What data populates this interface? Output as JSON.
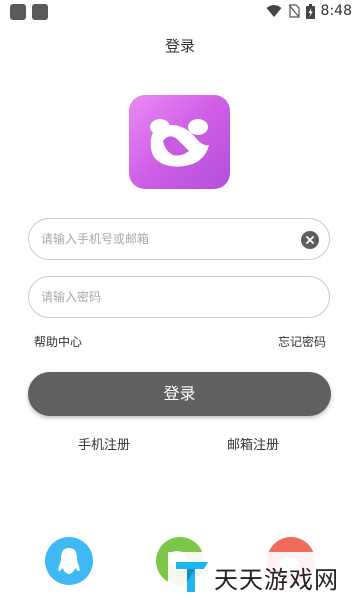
{
  "status_bar": {
    "time": "8:48",
    "icons": [
      "notification-square-icon",
      "notification-square-icon",
      "wifi-icon",
      "no-sim-icon",
      "battery-icon"
    ]
  },
  "header": {
    "title": "登录"
  },
  "form": {
    "account": {
      "placeholder": "请输入手机号或邮箱",
      "value": ""
    },
    "password": {
      "placeholder": "请输入密码",
      "value": ""
    },
    "help_label": "帮助中心",
    "forgot_label": "忘记密码",
    "login_label": "登录",
    "phone_register_label": "手机注册",
    "email_register_label": "邮箱注册"
  },
  "social": [
    "qq-icon",
    "wechat-icon",
    "weibo-icon"
  ],
  "watermark": {
    "text": "天天游戏网"
  },
  "colors": {
    "logo_gradient_start": "#ea8bf5",
    "logo_gradient_end": "#b24fda",
    "login_button": "#606060",
    "qq": "#3fb9f3",
    "wechat": "#7cc74a",
    "weibo": "#ef6b5a",
    "watermark_accent": "#1fb6f0"
  }
}
